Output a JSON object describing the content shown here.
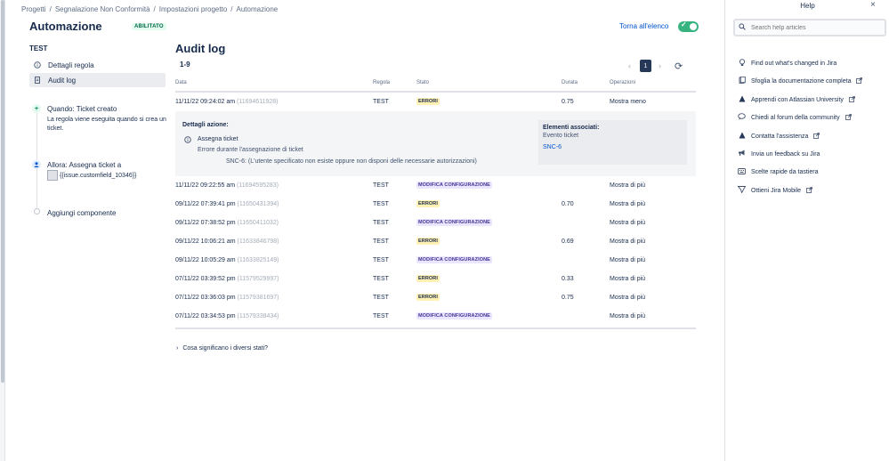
{
  "breadcrumb": {
    "items": [
      "Progetti",
      "Segnalazione Non Conformità",
      "Impostazioni progetto",
      "Automazione"
    ],
    "separator": "/"
  },
  "header": {
    "title": "Automazione",
    "badge": "ABILITATO",
    "back_link": "Torna all'elenco",
    "toggle_check": "✓"
  },
  "sidebar": {
    "rule_name": "TEST",
    "items": [
      {
        "label": "Dettagli regola",
        "icon": "info-icon"
      },
      {
        "label": "Audit log",
        "icon": "document-icon"
      }
    ]
  },
  "flow": {
    "trigger_title": "Quando: Ticket creato",
    "trigger_desc": "La regola viene eseguita quando si crea un ticket.",
    "trigger_symbol": "+",
    "action_title": "Allora: Assegna ticket a",
    "action_field": "{{issue.customfield_10346}}",
    "add_component": "Aggiungi componente"
  },
  "audit": {
    "title": "Audit log",
    "count": "1-9",
    "pager": {
      "prev": "‹",
      "page": "1",
      "next": "›",
      "refresh": "⟳"
    },
    "columns": {
      "date": "Data",
      "rule": "Regola",
      "status": "Stato",
      "duration": "Durata",
      "ops": "Operazioni"
    },
    "rows": [
      {
        "date": "11/11/22 09:24:02 am",
        "id": "(11694611928)",
        "rule": "TEST",
        "status": "ERRORI",
        "duration": "0.75",
        "ops": "Mostra meno"
      },
      {
        "date": "11/11/22 09:22:55 am",
        "id": "(11694595283)",
        "rule": "TEST",
        "status": "MODIFICA CONFIGURAZIONE",
        "duration": "",
        "ops": "Mostra di più"
      },
      {
        "date": "09/11/22 07:39:41 pm",
        "id": "(11650431394)",
        "rule": "TEST",
        "status": "ERRORI",
        "duration": "0.70",
        "ops": "Mostra di più"
      },
      {
        "date": "09/11/22 07:38:52 pm",
        "id": "(11650411032)",
        "rule": "TEST",
        "status": "MODIFICA CONFIGURAZIONE",
        "duration": "",
        "ops": "Mostra di più"
      },
      {
        "date": "09/11/22 10:06:21 am",
        "id": "(11633846798)",
        "rule": "TEST",
        "status": "ERRORI",
        "duration": "0.69",
        "ops": "Mostra di più"
      },
      {
        "date": "09/11/22 10:05:29 am",
        "id": "(11633825149)",
        "rule": "TEST",
        "status": "MODIFICA CONFIGURAZIONE",
        "duration": "",
        "ops": "Mostra di più"
      },
      {
        "date": "07/11/22 03:39:52 pm",
        "id": "(11579529997)",
        "rule": "TEST",
        "status": "ERRORI",
        "duration": "0.33",
        "ops": "Mostra di più"
      },
      {
        "date": "07/11/22 03:36:03 pm",
        "id": "(11579381697)",
        "rule": "TEST",
        "status": "ERRORI",
        "duration": "0.75",
        "ops": "Mostra di più"
      },
      {
        "date": "07/11/22 03:34:53 pm",
        "id": "(11579338434)",
        "rule": "TEST",
        "status": "MODIFICA CONFIGURAZIONE",
        "duration": "",
        "ops": "Mostra di più"
      }
    ],
    "detail": {
      "title": "Dettagli azione:",
      "action": "Assegna ticket",
      "error": "Errore durante l'assegnazione di ticket",
      "message": "SNC-6: (L'utente specificato non esiste oppure non disponi delle necessarie autorizzazioni)",
      "assoc_title": "Elementi associati:",
      "assoc_type": "Evento ticket",
      "assoc_link": "SNC-6"
    },
    "faq": "Cosa significano i diversi stati?",
    "faq_chevron": "›"
  },
  "help": {
    "title": "Help",
    "close": "×",
    "search_placeholder": "Search help articles",
    "links": [
      {
        "label": "Find out what's changed in Jira",
        "icon": "lightbulb-icon",
        "external": false
      },
      {
        "label": "Sfoglia la documentazione completa",
        "icon": "book-icon",
        "external": true
      },
      {
        "label": "Apprendi con Atlassian University",
        "icon": "atlassian-icon",
        "external": true
      },
      {
        "label": "Chiedi al forum della community",
        "icon": "chat-icon",
        "external": true
      },
      {
        "label": "Contatta l'assistenza",
        "icon": "atlassian-icon",
        "external": true
      },
      {
        "label": "Invia un feedback su Jira",
        "icon": "megaphone-icon",
        "external": false
      },
      {
        "label": "Scelte rapide da tastiera",
        "icon": "keyboard-icon",
        "external": false
      },
      {
        "label": "Ottieni Jira Mobile",
        "icon": "send-icon",
        "external": true
      }
    ]
  },
  "colors": {
    "accent": "#0052cc",
    "toggle_on": "#36b37e",
    "error_lozenge": "#fff0b3",
    "config_lozenge": "#eae6ff"
  }
}
